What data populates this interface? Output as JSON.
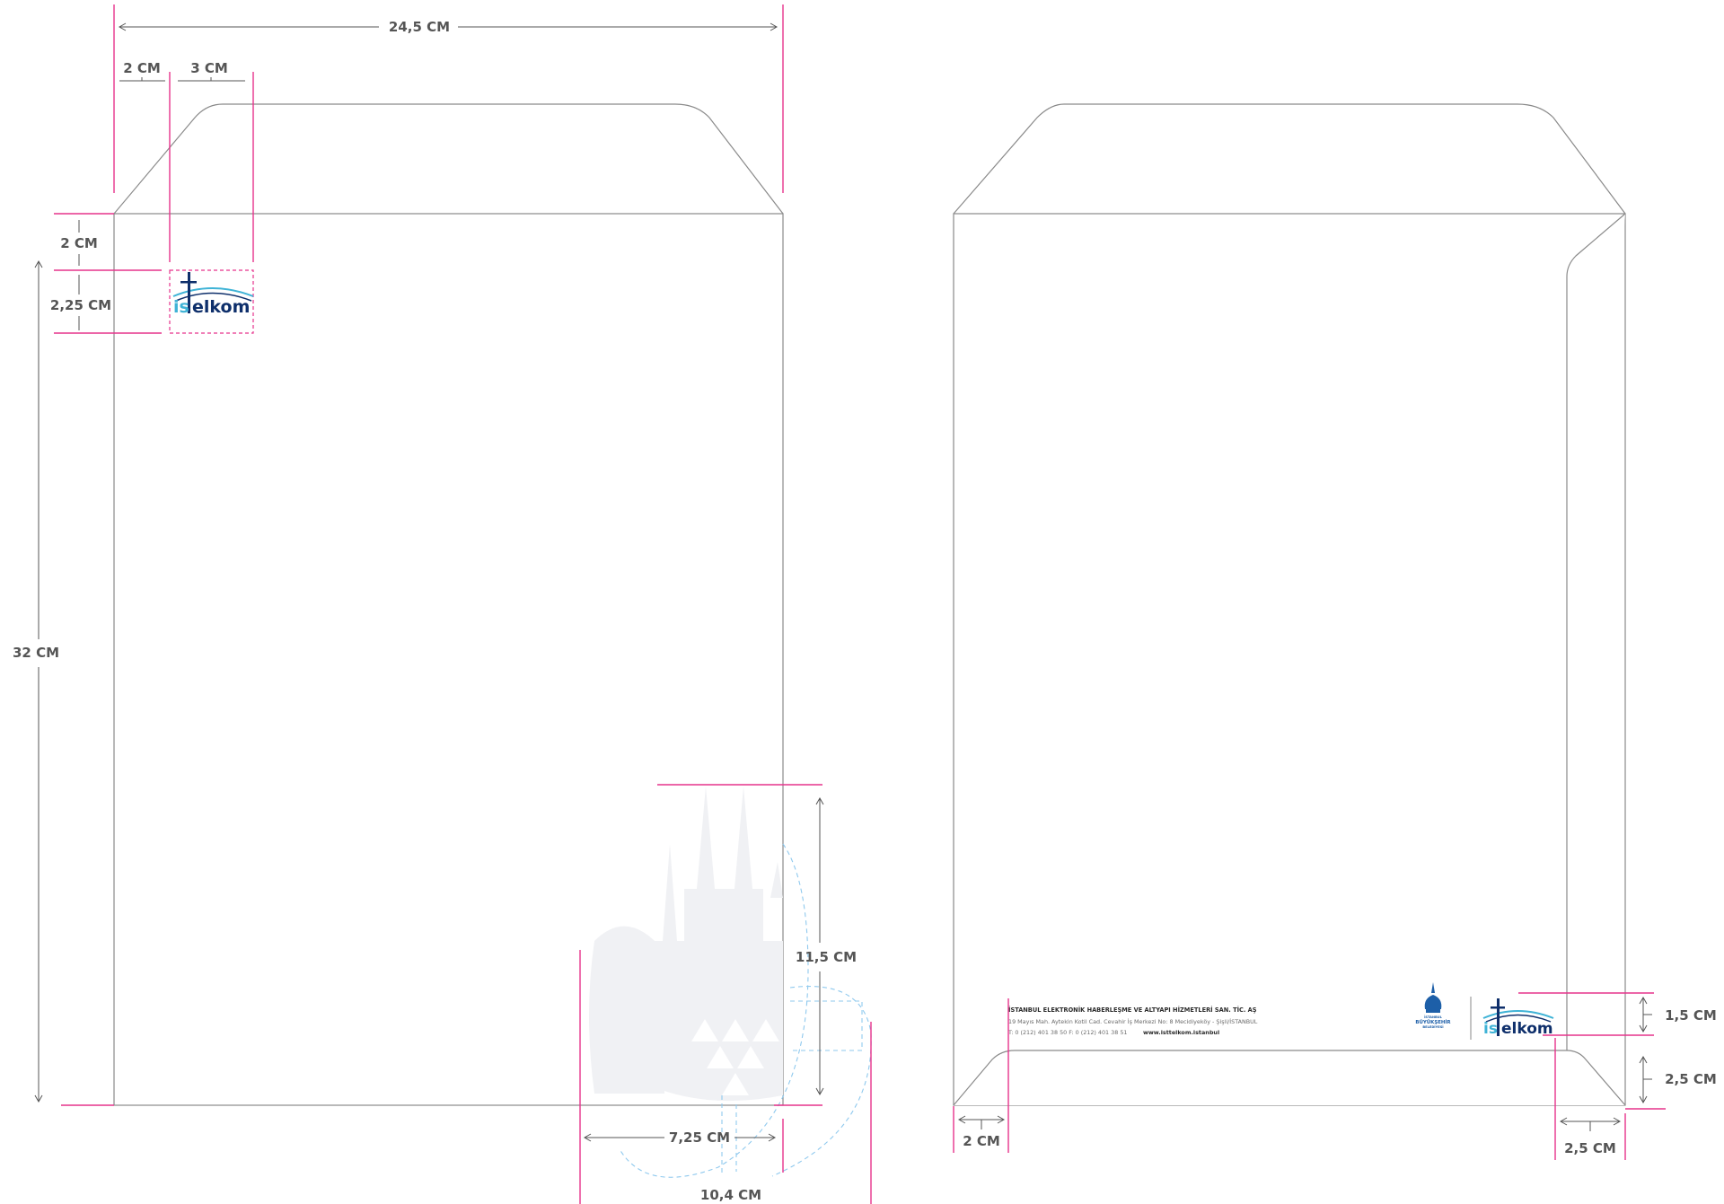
{
  "front": {
    "width_label": "24,5 CM",
    "height_label": "32 CM",
    "logo_left_label": "2 CM",
    "logo_width_label": "3 CM",
    "logo_top_label": "2 CM",
    "logo_height_label": "2,25 CM",
    "watermark_height_label": "11,5 CM",
    "watermark_inner_width_label": "7,25 CM",
    "watermark_width_label": "10,4 CM"
  },
  "back": {
    "left_margin_label": "2 CM",
    "right_margin_label": "2,5 CM",
    "logo_height_label": "1,5 CM",
    "logo_bottom_label": "2,5 CM",
    "company_name": "İSTANBUL ELEKTRONİK HABERLEŞME VE ALTYAPI HİZMETLERİ SAN. TİC. AŞ",
    "address": "19 Mayıs Mah. Aytekin Kotil Cad. Cevahir İş Merkezi No: 8 Mecidiyeköy - Şişli/İSTANBUL",
    "phone": "T: 0 (212) 401 38 50 F: 0 (212) 401 38 51",
    "website": "www.isttelkom.istanbul"
  },
  "logo": {
    "part1": "is",
    "part2": "elkom"
  },
  "ibb_logo": {
    "line1": "İSTANBUL",
    "line2": "BÜYÜKŞEHİR",
    "line3": "BELEDİYESİ"
  },
  "colors": {
    "guide_pink": "#e6338c",
    "logo_light_blue": "#3fb3d6",
    "logo_navy": "#0e2f6b",
    "watermark_grey": "#f0f1f4",
    "guide_blue": "#8fc9ee"
  }
}
